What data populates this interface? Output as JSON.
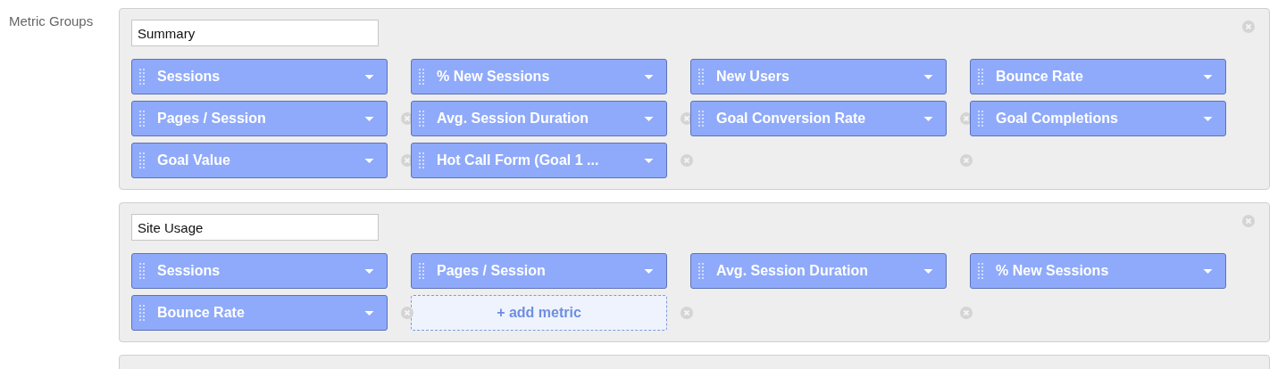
{
  "section_label": "Metric Groups",
  "groups": [
    {
      "name": "Summary",
      "rows": [
        [
          {
            "kind": "metric",
            "label": "Sessions",
            "removable": false
          },
          {
            "kind": "metric",
            "label": "% New Sessions",
            "removable": false
          },
          {
            "kind": "metric",
            "label": "New Users",
            "removable": false
          },
          {
            "kind": "metric",
            "label": "Bounce Rate",
            "removable": false
          }
        ],
        [
          {
            "kind": "metric",
            "label": "Pages / Session",
            "removable": false
          },
          {
            "kind": "metric",
            "label": "Avg. Session Duration",
            "removable": true
          },
          {
            "kind": "metric",
            "label": "Goal Conversion Rate",
            "removable": true
          },
          {
            "kind": "metric",
            "label": "Goal Completions",
            "removable": true
          }
        ],
        [
          {
            "kind": "metric",
            "label": "Goal Value",
            "removable": false
          },
          {
            "kind": "metric",
            "label": "Hot Call Form (Goal 1 ...",
            "removable": true
          },
          {
            "kind": "empty",
            "removable": true
          },
          {
            "kind": "empty",
            "removable": true
          }
        ]
      ]
    },
    {
      "name": "Site Usage",
      "rows": [
        [
          {
            "kind": "metric",
            "label": "Sessions",
            "removable": false
          },
          {
            "kind": "metric",
            "label": "Pages / Session",
            "removable": false
          },
          {
            "kind": "metric",
            "label": "Avg. Session Duration",
            "removable": false
          },
          {
            "kind": "metric",
            "label": "% New Sessions",
            "removable": false
          }
        ],
        [
          {
            "kind": "metric",
            "label": "Bounce Rate",
            "removable": false
          },
          {
            "kind": "add",
            "label": "+ add metric",
            "removable": true
          },
          {
            "kind": "empty",
            "removable": true
          },
          {
            "kind": "empty",
            "removable": true
          }
        ]
      ]
    }
  ],
  "has_more_groups": true
}
